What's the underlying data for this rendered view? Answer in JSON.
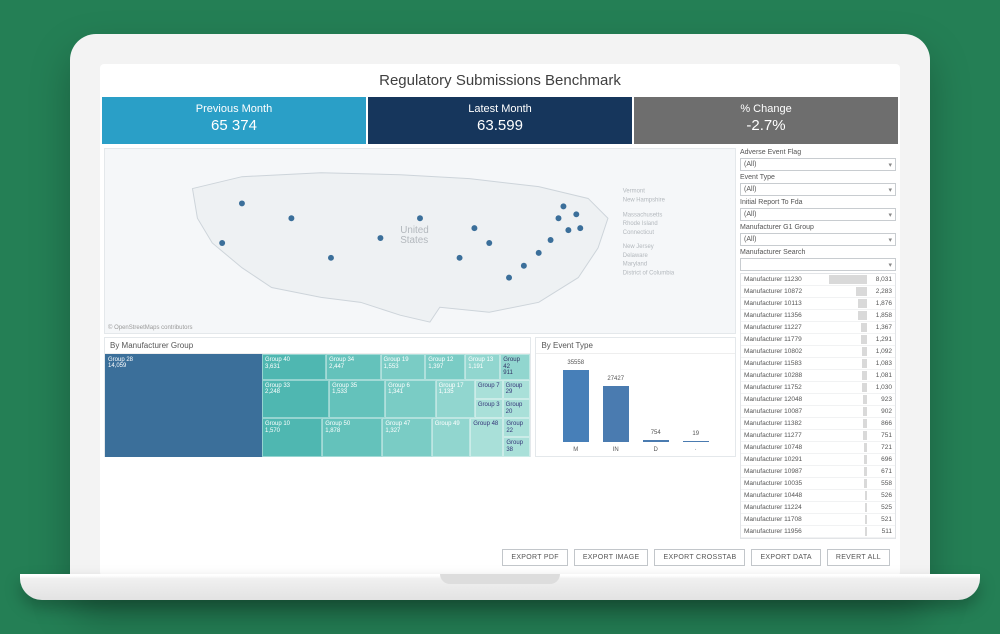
{
  "title": "Regulatory Submissions Benchmark",
  "kpis": {
    "prev": {
      "label": "Previous Month",
      "value": "65 374"
    },
    "latest": {
      "label": "Latest Month",
      "value": "63.599"
    },
    "change": {
      "label": "% Change",
      "value": "-2.7%"
    }
  },
  "map": {
    "attribution": "© OpenStreetMaps contributors"
  },
  "filters": {
    "adverse_label": "Adverse Event Flag",
    "adverse_value": "(All)",
    "event_label": "Event Type",
    "event_value": "(All)",
    "report_label": "Initial Report To Fda",
    "report_value": "(All)",
    "mgroup_label": "Manufacturer G1 Group",
    "mgroup_value": "(All)",
    "search_label": "Manufacturer Search"
  },
  "manufacturers": [
    {
      "name": "Manufacturer 11230",
      "value": "8,031"
    },
    {
      "name": "Manufacturer 10872",
      "value": "2,283"
    },
    {
      "name": "Manufacturer 10113",
      "value": "1,876"
    },
    {
      "name": "Manufacturer 11356",
      "value": "1,858"
    },
    {
      "name": "Manufacturer 11227",
      "value": "1,367"
    },
    {
      "name": "Manufacturer 11779",
      "value": "1,291"
    },
    {
      "name": "Manufacturer 10802",
      "value": "1,092"
    },
    {
      "name": "Manufacturer 11583",
      "value": "1,083"
    },
    {
      "name": "Manufacturer 10288",
      "value": "1,081"
    },
    {
      "name": "Manufacturer 11752",
      "value": "1,030"
    },
    {
      "name": "Manufacturer 12048",
      "value": "923"
    },
    {
      "name": "Manufacturer 10087",
      "value": "902"
    },
    {
      "name": "Manufacturer 11382",
      "value": "866"
    },
    {
      "name": "Manufacturer 11277",
      "value": "751"
    },
    {
      "name": "Manufacturer 10748",
      "value": "721"
    },
    {
      "name": "Manufacturer 10291",
      "value": "696"
    },
    {
      "name": "Manufacturer 10987",
      "value": "671"
    },
    {
      "name": "Manufacturer 10035",
      "value": "558"
    },
    {
      "name": "Manufacturer 10448",
      "value": "526"
    },
    {
      "name": "Manufacturer 11224",
      "value": "525"
    },
    {
      "name": "Manufacturer 11708",
      "value": "521"
    },
    {
      "name": "Manufacturer 11956",
      "value": "511"
    }
  ],
  "treemap": {
    "title": "By Manufacturer Group",
    "big": {
      "name": "Group 28",
      "value": "14,059"
    },
    "cells": [
      {
        "name": "Group 40",
        "value": "3,631"
      },
      {
        "name": "Group 34",
        "value": "2,447"
      },
      {
        "name": "Group 19",
        "value": "1,553"
      },
      {
        "name": "Group 12",
        "value": "1,397"
      },
      {
        "name": "Group 13",
        "value": "1,191"
      },
      {
        "name": "Group 42",
        "value": "911"
      },
      {
        "name": "Group 33",
        "value": "2,248"
      },
      {
        "name": "Group 35",
        "value": "1,533"
      },
      {
        "name": "Group 6",
        "value": "1,341"
      },
      {
        "name": "Group 17",
        "value": "1,135"
      },
      {
        "name": "Group 7",
        "value": ""
      },
      {
        "name": "Group 29",
        "value": ""
      },
      {
        "name": "Group 10",
        "value": "1,570"
      },
      {
        "name": "Group 50",
        "value": "1,878"
      },
      {
        "name": "Group 47",
        "value": "1,327"
      },
      {
        "name": "Group 49",
        "value": ""
      },
      {
        "name": "Group 48",
        "value": ""
      },
      {
        "name": "Group 3",
        "value": ""
      },
      {
        "name": "Group 20",
        "value": ""
      },
      {
        "name": "Group 22",
        "value": ""
      },
      {
        "name": "Group 38",
        "value": ""
      }
    ]
  },
  "chart_data": {
    "type": "bar",
    "title": "By Event Type",
    "categories": [
      "M",
      "IN",
      "D",
      "·"
    ],
    "values": [
      35558,
      27427,
      754,
      19
    ],
    "ylim": [
      0,
      36000
    ]
  },
  "buttons": {
    "pdf": "EXPORT PDF",
    "image": "EXPORT IMAGE",
    "crosstab": "EXPORT CROSSTAB",
    "data": "EXPORT DATA",
    "revert": "REVERT ALL"
  },
  "state_labels": [
    "Vermont",
    "New Hampshire",
    "Massachusetts",
    "Rhode Island",
    "Connecticut",
    "New Jersey",
    "Delaware",
    "Maryland",
    "District of Columbia"
  ]
}
